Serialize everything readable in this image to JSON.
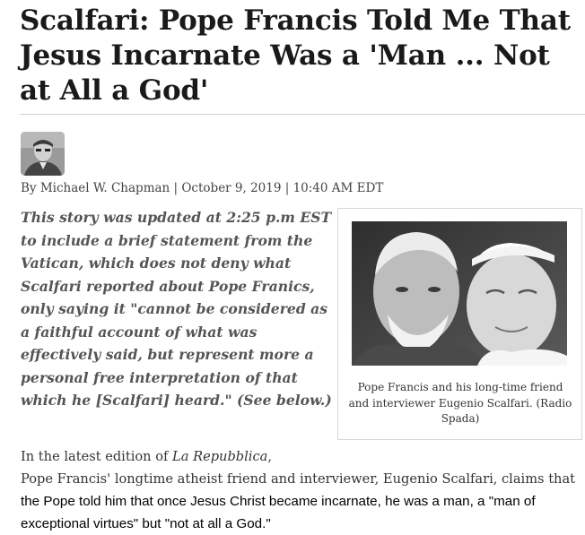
{
  "article": {
    "headline": "Scalfari: Pope Francis Told Me That Jesus Incarnate Was a 'Man ... Not at All a God'",
    "byline": "By Michael W. Chapman | October 9, 2019 | 10:40 AM EDT",
    "update_note": "This story was updated at 2:25 p.m EST to include a brief statement from the Vatican, which does not deny what Scalfari reported about Pope Franics, only saying it \"cannot be considered as a faithful account of what was effectively said, but represent more a personal free interpretation of that which he [Scalfari] heard.\" (See below.)",
    "figure_caption": "Pope Francis and his long-time friend and interviewer Eugenio Scalfari. (Radio Spada)",
    "body": {
      "intro": "In the latest edition of ",
      "publication": "La Repubblica",
      "line2": "Pope Francis' longtime atheist friend and interviewer, Eugenio Scalfari, claims that ",
      "highlight": "the Pope told him that once Jesus Christ became incarnate, he was a man, a \"man of exceptional virtues\" but \"not at all a God.\""
    }
  }
}
